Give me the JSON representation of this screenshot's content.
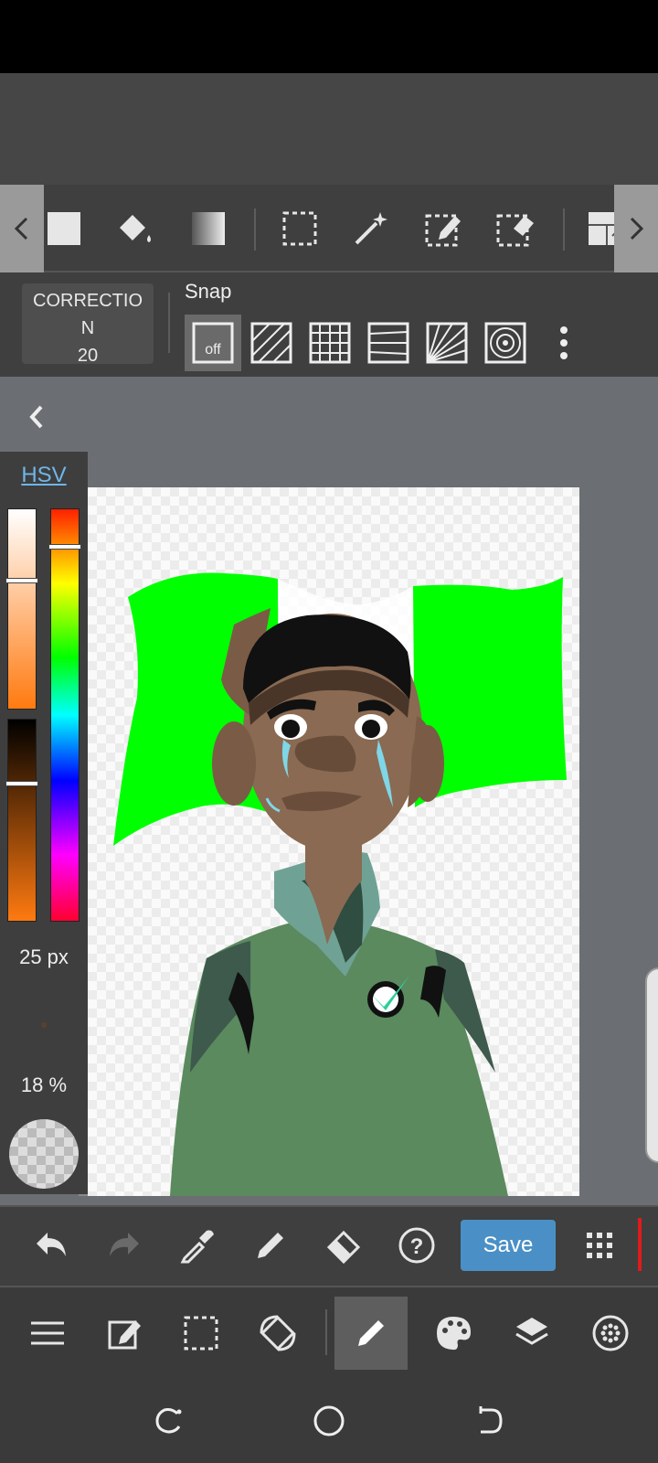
{
  "options": {
    "correction_label": "CORRECTION",
    "correction_value": "20",
    "snap_label": "Snap",
    "snap_off_label": "off"
  },
  "color_panel": {
    "mode_label": "HSV",
    "brush_size": "25 px",
    "opacity": "18 %",
    "hue_level": 0.09,
    "saturation_level": 0.36,
    "value_level": 0.32
  },
  "actions": {
    "save_label": "Save"
  },
  "colors": {
    "accent_blue": "#4a90c6",
    "flag_green": "#00ff00",
    "jacket_green": "#5a8a5e",
    "skin": "#8a6a52"
  },
  "icons": {
    "toolbar": [
      "chevron-left-icon",
      "fill-rect-icon",
      "bucket-icon",
      "gradient-icon",
      "select-rect-icon",
      "magic-wand-icon",
      "select-pen-icon",
      "select-eraser-icon",
      "panel-icon",
      "chevron-right-icon"
    ],
    "snap": [
      "snap-off-icon",
      "snap-parallel-icon",
      "snap-grid-icon",
      "snap-perspective-icon",
      "snap-radial-icon",
      "snap-circle-icon",
      "more-vert-icon"
    ],
    "actions": [
      "undo-icon",
      "redo-icon",
      "eyedropper-icon",
      "pencil-icon",
      "eraser-icon",
      "help-icon",
      "grid-dots-icon"
    ],
    "nav": [
      "menu-icon",
      "edit-icon",
      "selection-icon",
      "transform-icon",
      "brush-icon",
      "palette-icon",
      "layers-icon",
      "material-icon"
    ],
    "system": [
      "recent-apps-icon",
      "home-icon",
      "back-icon"
    ]
  }
}
